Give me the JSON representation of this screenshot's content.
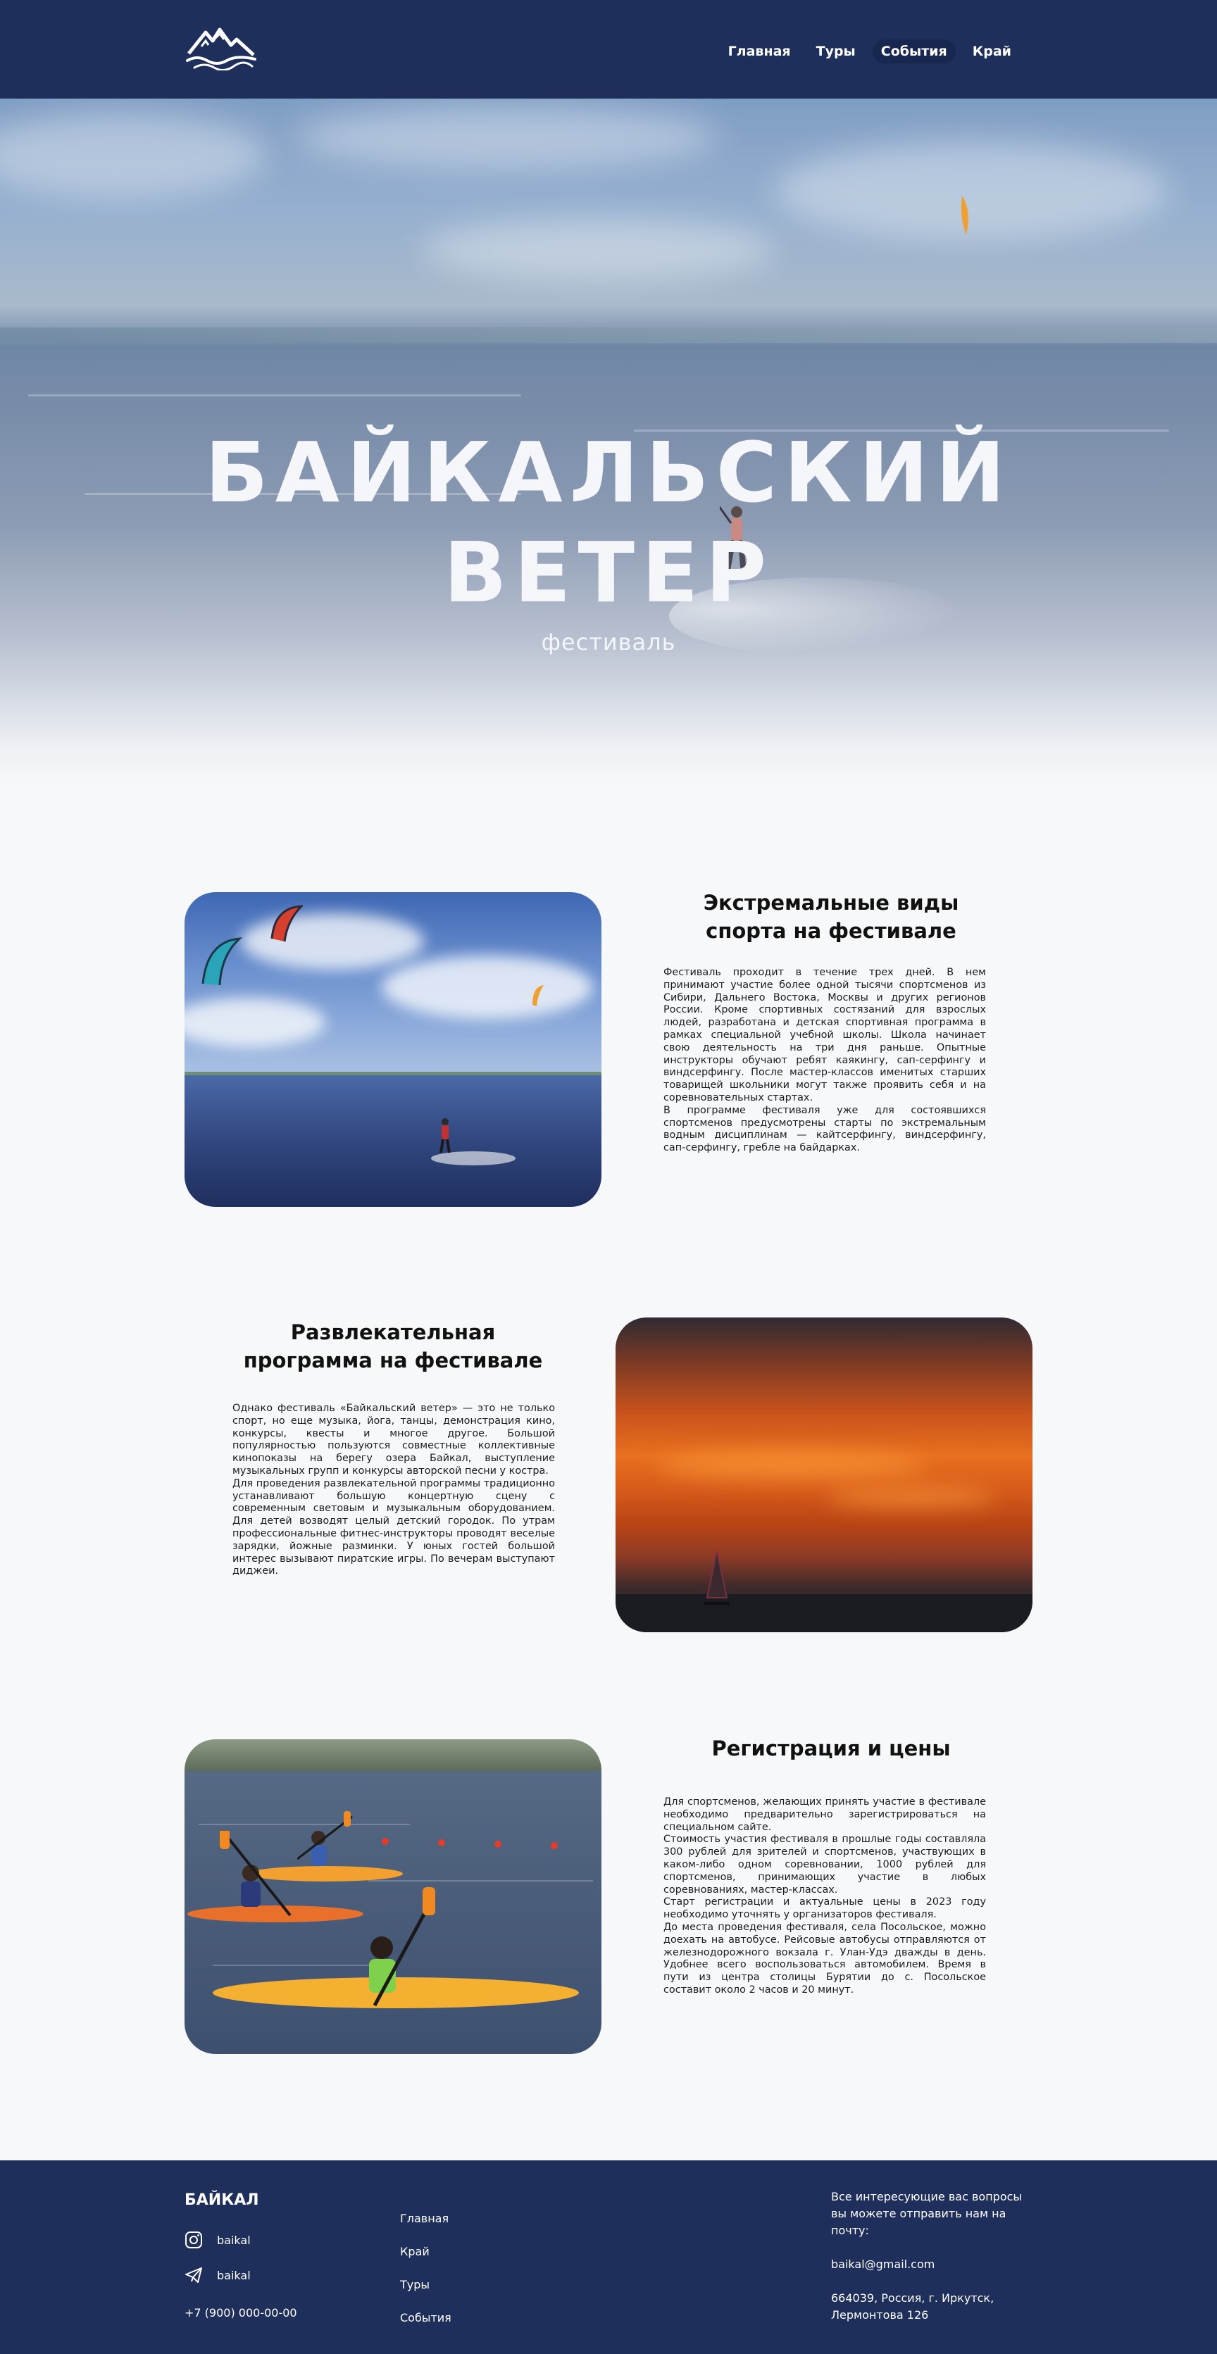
{
  "header": {
    "logo_icon": "mountain-waves-logo",
    "nav": [
      {
        "label": "Главная",
        "active": false
      },
      {
        "label": "Туры",
        "active": false
      },
      {
        "label": "События",
        "active": true
      },
      {
        "label": "Край",
        "active": false
      }
    ]
  },
  "hero": {
    "title_line1": "БАЙКАЛЬСКИЙ",
    "title_line2": "ВЕТЕР",
    "subtitle": "фестиваль"
  },
  "sections": [
    {
      "title_line1": "Экстремальные виды",
      "title_line2": "спорта на фестивале",
      "paragraphs": [
        "Фестиваль проходит в течение трех дней. В нем принимают участие более одной тысячи спортсменов из Сибири, Дальнего Востока, Москвы и других регионов России. Кроме спортивных состязаний для взрослых людей, разработана и детская спортивная программа в рамках специальной учебной школы. Школа начинает свою деятельность на три дня раньше. Опытные инструкторы обучают ребят каякингу, сап-серфингу и виндсерфингу. После мастер-классов именитых старших товарищей школьники могут также проявить себя и на соревновательных стартах.",
        "В программе фестиваля уже для состоявшихся спортсменов предусмотрены старты по экстремальным водным дисциплинам — кайтсерфингу, виндсерфингу, сап-серфингу, гребле на байдарках."
      ]
    },
    {
      "title_line1": "Развлекательная",
      "title_line2": "программа на фестивале",
      "paragraphs": [
        "Однако фестиваль «Байкальский ветер» — это не только спорт, но еще музыка, йога, танцы, демонстрация кино, конкурсы, квесты и многое другое. Большой популярностью пользуются совместные коллективные кинопоказы на берегу озера Байкал, выступление музыкальных групп и конкурсы авторской песни у костра.",
        "Для проведения развлекательной программы традиционно устанавливают большую концертную сцену с современным световым и музыкальным оборудованием. Для детей возводят целый детский городок. По утрам профессиональные фитнес-инструкторы проводят веселые зарядки, йожные разминки. У юных гостей большой интерес вызывают пиратские игры. По вечерам выступают диджеи."
      ]
    },
    {
      "title_line1": "Регистрация и цены",
      "title_line2": "",
      "paragraphs": [
        "Для спортсменов, желающих принять участие в фестивале необходимо предварительно зарегистрироваться на специальном сайте.",
        "Стоимость участия фестиваля в прошлые годы составляла 300 рублей для зрителей и спортсменов, участвующих в каком-либо одном соревновании, 1000 рублей для спортсменов, принимающих участие в любых соревнованиях, мастер-классах.",
        "Старт регистрации и актуальные цены в 2023 году необходимо уточнять у организаторов фестиваля.",
        "До места проведения фестиваля, села Посольское, можно доехать на автобусе. Рейсовые автобусы отправляются от железнодорожного вокзала г. Улан-Удэ дважды в день. Удобнее всего воспользоваться автомобилем. Время в пути из центра столицы Бурятии до с. Посольское составит около 2 часов и 20 минут."
      ]
    }
  ],
  "footer": {
    "brand": "БАЙКАЛ",
    "instagram": {
      "icon": "instagram-icon",
      "label": "baikal"
    },
    "telegram": {
      "icon": "telegram-icon",
      "label": "baikal"
    },
    "phone": "+7 (900) 000-00-00",
    "links": [
      "Главная",
      "Край",
      "Туры",
      "События"
    ],
    "contact_text": "Все интересующие вас вопросы вы можете отправить нам на почту:",
    "email": "baikal@gmail.com",
    "address_line1": "664039, Россия, г. Иркутск,",
    "address_line2": "Лермонтова 126"
  }
}
